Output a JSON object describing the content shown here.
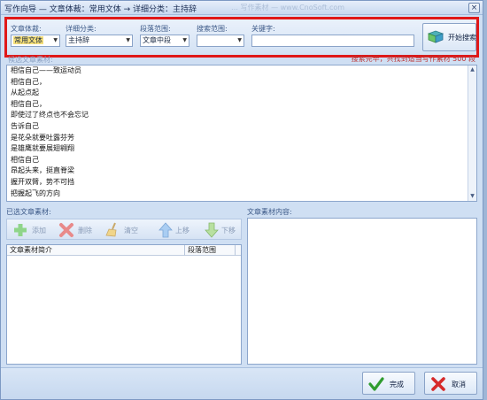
{
  "window": {
    "title": "写作向导 — 文章体裁：常用文体 → 详细分类：主持辞",
    "ghost_text": "… 写作素材 — www.CnoSoft.com",
    "close_glyph": "×"
  },
  "search": {
    "genre_label": "文章体裁:",
    "genre_value": "常用文体",
    "category_label": "详细分类:",
    "category_value": "主持辞",
    "paragraph_label": "段落范围:",
    "paragraph_value": "文章中段",
    "scope_label": "搜索范围:",
    "scope_value": "",
    "keyword_label": "关键字:",
    "keyword_value": "",
    "search_button": "开始搜索"
  },
  "results": {
    "label": "候选文章素材:",
    "status": "搜索完毕，共找到适当写作素材 500 段",
    "items": [
      "相信自己——致运动员",
      "相信自己，",
      "从起点起",
      "相信自己，",
      "即使过了终点也不会忘记",
      "告诉自己",
      "是花朵就要吐露芬芳",
      "是雄鹰就要展翅翱翔",
      "相信自己",
      "昂起头来，挺直脊梁",
      "握开双臂，势不可挡",
      "把握起飞的方向"
    ]
  },
  "selected": {
    "label": "已选文章素材:",
    "toolbar": {
      "add": "添加",
      "delete": "删除",
      "clear": "清空",
      "up": "上移",
      "down": "下移"
    },
    "columns": [
      "文章素材简介",
      "段落范围"
    ]
  },
  "content": {
    "label": "文章素材内容:"
  },
  "footer": {
    "finish": "完成",
    "cancel": "取消"
  },
  "colors": {
    "highlight_border": "#e01818",
    "window_bg": "#cfdff3"
  }
}
